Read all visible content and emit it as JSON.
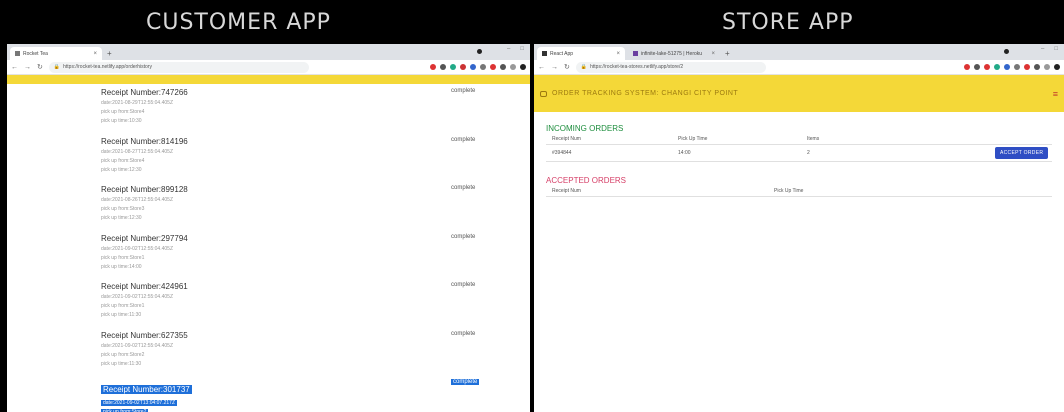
{
  "headings": {
    "customer": "CUSTOMER APP",
    "store": "STORE APP"
  },
  "customer": {
    "tab_title": "Rocket Tea",
    "url": "https://rocket-tea.netlify.app/orderhistory",
    "receipts": [
      {
        "number": "Receipt Number:747266",
        "date": "date:2021-08-29T12:55:04.405Z",
        "pickup_from": "pick up from:Store4",
        "pickup_time": "pick up time:10:30",
        "status": "complete"
      },
      {
        "number": "Receipt Number:814196",
        "date": "date:2021-08-27T12:55:04.405Z",
        "pickup_from": "pick up from:Store4",
        "pickup_time": "pick up time:12:30",
        "status": "complete"
      },
      {
        "number": "Receipt Number:899128",
        "date": "date:2021-08-26T12:55:04.405Z",
        "pickup_from": "pick up from:Store3",
        "pickup_time": "pick up time:12:30",
        "status": "complete"
      },
      {
        "number": "Receipt Number:297794",
        "date": "date:2021-09-02T12:55:04.405Z",
        "pickup_from": "pick up from:Store1",
        "pickup_time": "pick up time:14:00",
        "status": "complete"
      },
      {
        "number": "Receipt Number:424961",
        "date": "date:2021-09-02T12:55:04.405Z",
        "pickup_from": "pick up from:Store1",
        "pickup_time": "pick up time:11:30",
        "status": "complete"
      },
      {
        "number": "Receipt Number:627355",
        "date": "date:2021-09-02T12:55:04.405Z",
        "pickup_from": "pick up from:Store2",
        "pickup_time": "pick up time:11:30",
        "status": "complete"
      },
      {
        "number": "Receipt Number:301737",
        "date": "date:2021-09-02T13:04:07.217Z",
        "pickup_from": "pick up from:Store2",
        "pickup_time": "",
        "status": "complete"
      }
    ]
  },
  "store": {
    "tab_title": "React App",
    "tab2_title": "infinite-lake-51275 | Heroku",
    "url": "https://rocket-tea-stores.netlify.app/store/2",
    "app_title": "ORDER TRACKING SYSTEM: CHANGI CITY POINT",
    "incoming": {
      "title": "INCOMING ORDERS",
      "headers": [
        "Receipt Num",
        "Pick Up Time",
        "Items"
      ],
      "rows": [
        {
          "receipt": "#394844",
          "time": "14:00",
          "items": "2",
          "action": "ACCEPT ORDER"
        }
      ]
    },
    "accepted": {
      "title": "ACCEPTED ORDERS",
      "headers": [
        "Receipt Num",
        "Pick Up Time"
      ]
    }
  },
  "colors": {
    "accent_yellow": "#f4d838",
    "accept_button": "#2f4ec4",
    "incoming_green": "#1e8e3e",
    "accepted_red": "#d64068",
    "selection_blue": "#1e6fd9"
  },
  "icons": [
    "favicon-icon",
    "close-icon",
    "new-tab-icon",
    "back-icon",
    "forward-icon",
    "reload-icon",
    "lock-icon",
    "menu-icon",
    "logo-icon"
  ]
}
